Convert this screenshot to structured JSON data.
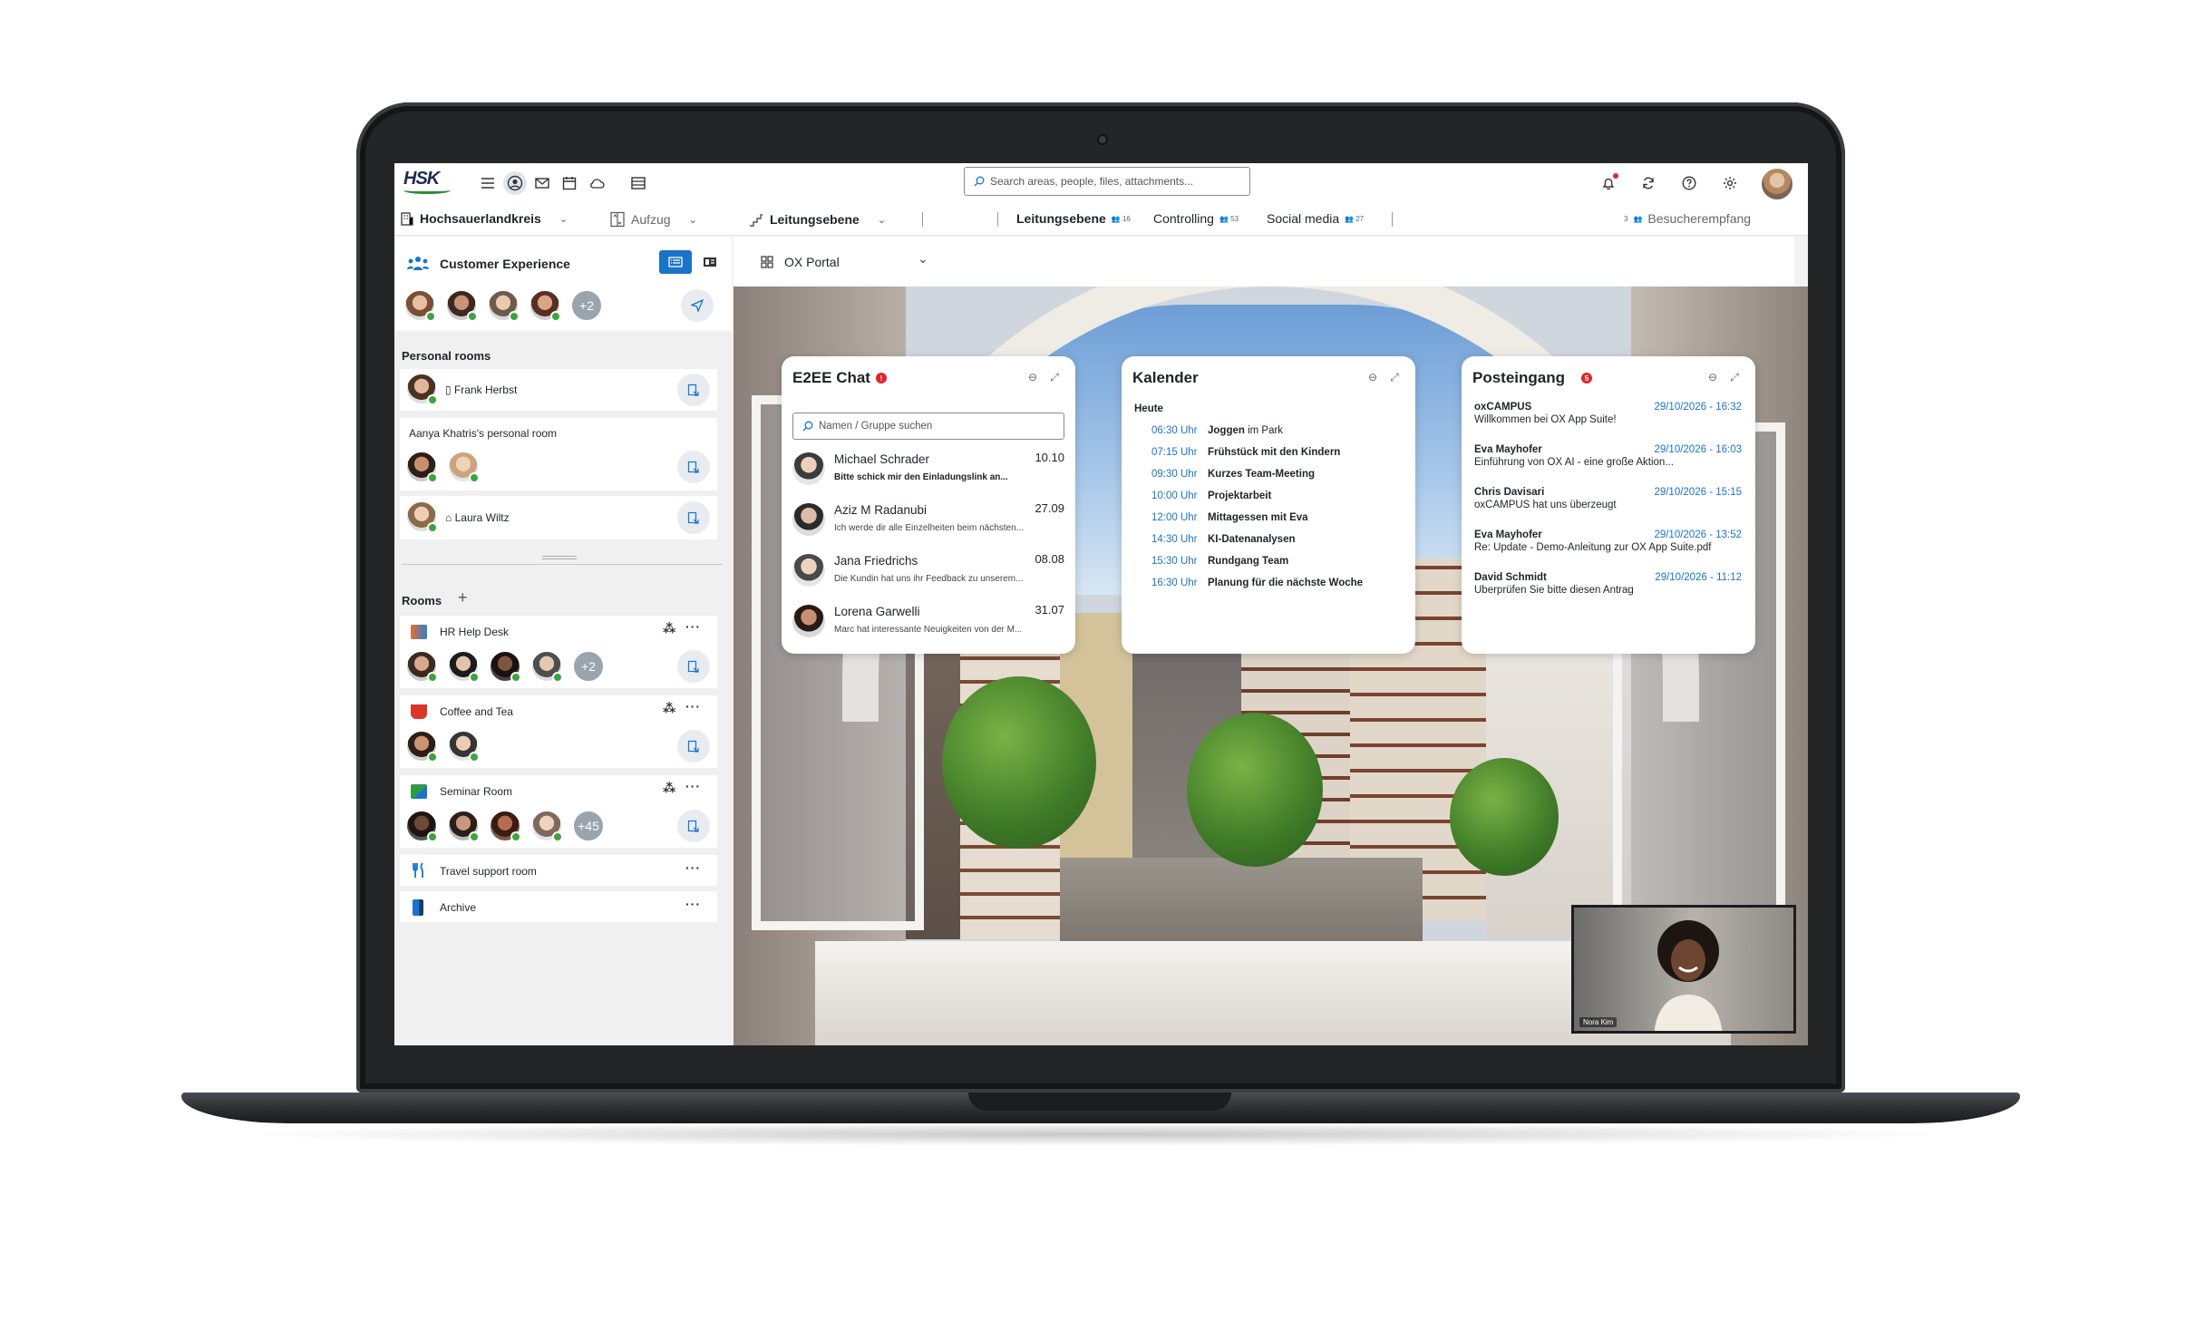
{
  "topbar": {
    "logo_text": "HSK",
    "search_placeholder": "Search areas, people, files, attachments...",
    "icons": [
      "menu-icon",
      "portal-icon",
      "mail-icon",
      "calendar-icon",
      "cloud-icon",
      "table-icon",
      "bell-icon",
      "sync-icon",
      "help-icon",
      "settings-icon"
    ]
  },
  "tabbar": {
    "org": "Hochsauerlandkreis",
    "floor": "Aufzug",
    "level": "Leitungsebene",
    "tabs": [
      {
        "label": "Leitungsebene",
        "count": "16"
      },
      {
        "label": "Controlling",
        "count": "53"
      },
      {
        "label": "Social media",
        "count": "27"
      }
    ],
    "visitor_count": "3",
    "visitor_label": "Besucherempfang"
  },
  "sidebar": {
    "header_title": "Customer Experience",
    "header_more": "+2",
    "personal_rooms_title": "Personal rooms",
    "personal_rooms": [
      {
        "label": "Frank Herbst"
      },
      {
        "label": "Aanya Khatris's personal room"
      },
      {
        "label": "Laura Wiltz"
      }
    ],
    "rooms_title": "Rooms",
    "rooms": [
      {
        "label": "HR Help Desk",
        "more": "+2"
      },
      {
        "label": "Coffee and Tea"
      },
      {
        "label": "Seminar Room",
        "more": "+45"
      },
      {
        "label": "Travel support room"
      },
      {
        "label": "Archive"
      }
    ],
    "dots": "···"
  },
  "portal": {
    "label": "OX Portal"
  },
  "chat": {
    "title": "E2EE Chat",
    "badge": "!",
    "search_placeholder": "Namen / Gruppe suchen",
    "items": [
      {
        "name": "Michael Schrader",
        "time": "10.10",
        "msg": "Bitte schick mir den Einladungslink an...",
        "msg_bold": true
      },
      {
        "name": "Aziz M Radanubi",
        "time": "27.09",
        "msg": "Ich werde dir alle Einzelheiten beim nächsten..."
      },
      {
        "name": "Jana Friedrichs",
        "time": "08.08",
        "msg": "Die Kundin hat uns ihr Feedback zu unserem..."
      },
      {
        "name": "Lorena Garwelli",
        "time": "31.07",
        "msg": "Marc hat interessante Neuigkeiten von der M..."
      }
    ]
  },
  "calendar": {
    "title": "Kalender",
    "today": "Heute",
    "events": [
      {
        "time": "06:30 Uhr",
        "title": "Joggen",
        "suffix": " im Park"
      },
      {
        "time": "07:15 Uhr",
        "title": "Frühstück mit den Kindern",
        "suffix": ""
      },
      {
        "time": "09:30 Uhr",
        "title": "Kurzes Team-Meeting",
        "suffix": ""
      },
      {
        "time": "10:00 Uhr",
        "title": "Projektarbeit",
        "suffix": ""
      },
      {
        "time": "12:00 Uhr",
        "title": "Mittagessen mit Eva",
        "suffix": ""
      },
      {
        "time": "14:30 Uhr",
        "title": "KI-Datenanalysen",
        "suffix": ""
      },
      {
        "time": "15:30 Uhr",
        "title": "Rundgang Team",
        "suffix": ""
      },
      {
        "time": "16:30 Uhr",
        "title": "Planung für die nächste Woche",
        "suffix": ""
      }
    ]
  },
  "inbox": {
    "title": "Posteingang",
    "badge": "5",
    "mails": [
      {
        "from": "oxCAMPUS",
        "date": "29/10/2026 - 16:32",
        "subject": "Willkommen bei OX App Suite!"
      },
      {
        "from": "Eva Mayhofer",
        "date": "29/10/2026 - 16:03",
        "subject": "Einführung von OX AI - eine große Aktion..."
      },
      {
        "from": "Chris Davisari",
        "date": "29/10/2026 - 15:15",
        "subject": "oxCAMPUS hat uns überzeugt"
      },
      {
        "from": "Eva Mayhofer",
        "date": "29/10/2026 - 13:52",
        "subject": "Re: Update - Demo-Anleitung zur OX App Suite.pdf"
      },
      {
        "from": "David Schmidt",
        "date": "29/10/2026 - 11:12",
        "subject": "Überprüfen Sie bitte diesen Antrag"
      }
    ]
  },
  "video": {
    "name": "Nora Kim"
  },
  "colors": {
    "accent": "#1a73c9",
    "online": "#3ca43f",
    "alert": "#e0242b"
  }
}
